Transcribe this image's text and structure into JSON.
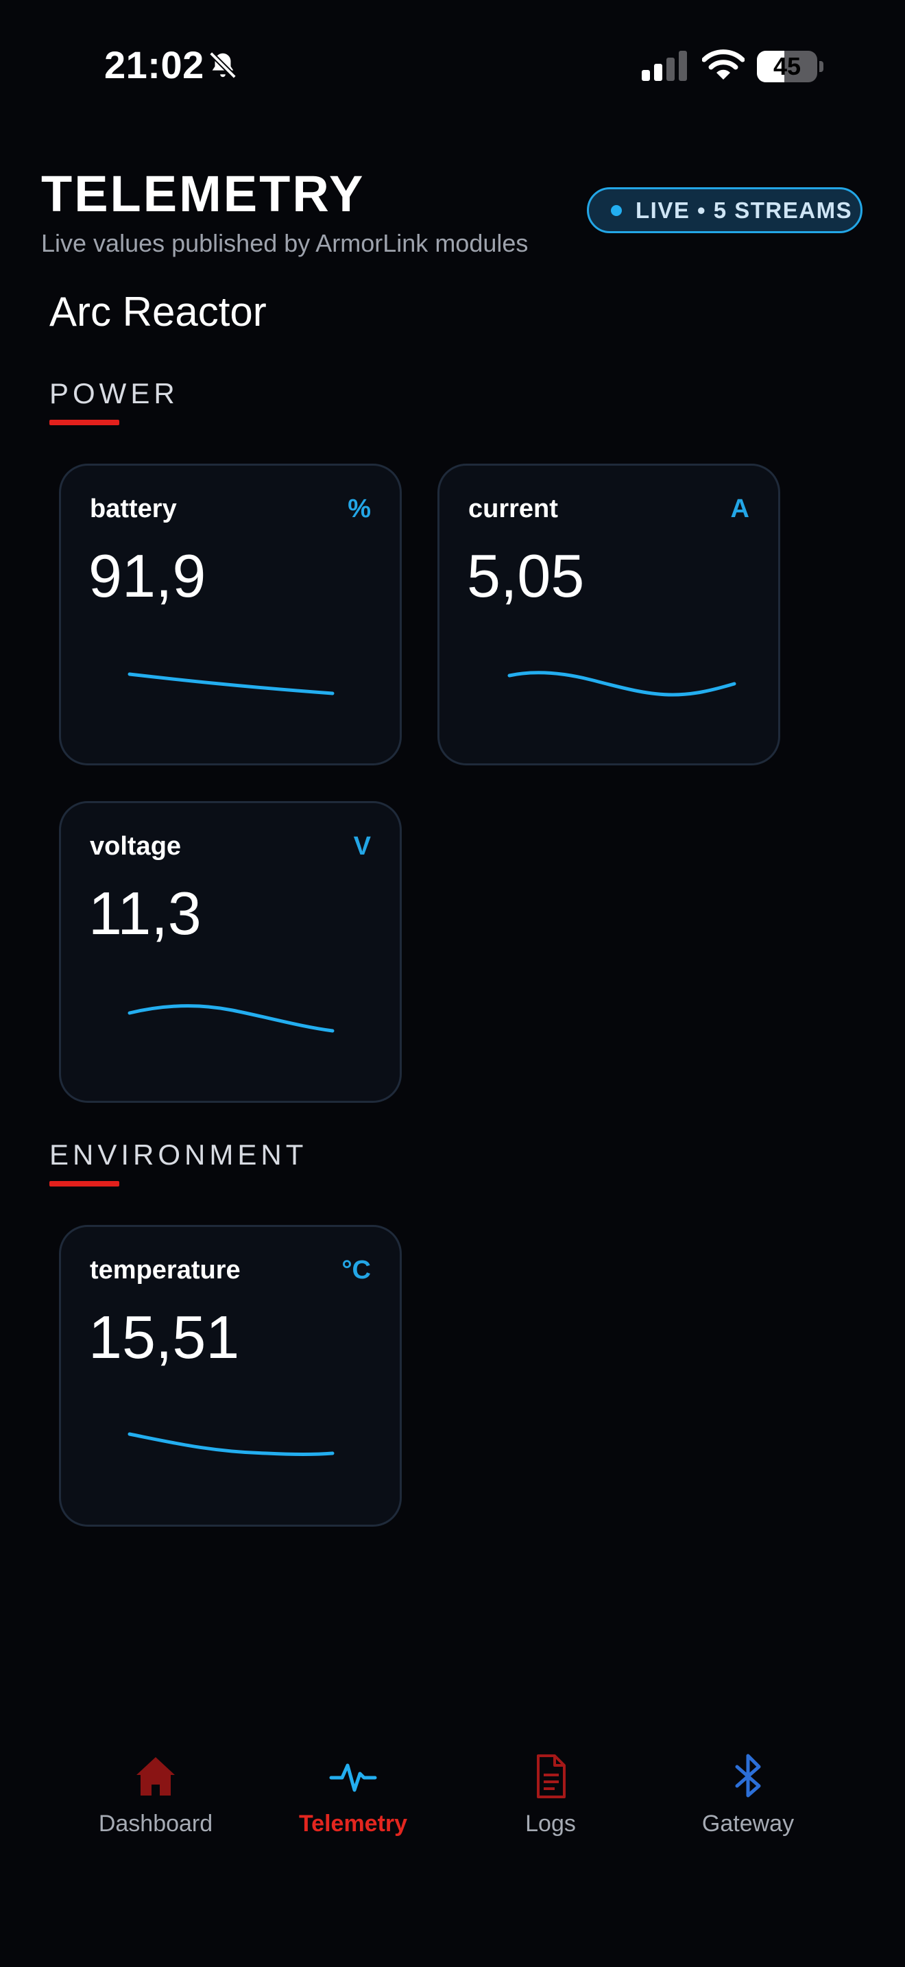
{
  "status_bar": {
    "time": "21:02",
    "silent_icon": "bell-slash-icon",
    "battery_level": "45",
    "battery_fraction": 0.45
  },
  "header": {
    "title": "TELEMETRY",
    "subtitle": "Live values published by ArmorLink modules",
    "live_badge": "LIVE • 5 STREAMS"
  },
  "device": {
    "name": "Arc Reactor"
  },
  "sections": [
    {
      "label": "POWER",
      "metrics": [
        {
          "name": "battery",
          "unit": "%",
          "value": "91,9"
        },
        {
          "name": "current",
          "unit": "A",
          "value": "5,05"
        },
        {
          "name": "voltage",
          "unit": "V",
          "value": "11,3"
        }
      ]
    },
    {
      "label": "ENVIRONMENT",
      "metrics": [
        {
          "name": "temperature",
          "unit": "°C",
          "value": "15,51"
        }
      ]
    }
  ],
  "tabs": [
    {
      "label": "Dashboard",
      "icon": "house-icon",
      "active": false
    },
    {
      "label": "Telemetry",
      "icon": "pulse-icon",
      "active": true
    },
    {
      "label": "Logs",
      "icon": "document-icon",
      "active": false
    },
    {
      "label": "Gateway",
      "icon": "bluetooth-icon",
      "active": false
    }
  ],
  "colors": {
    "background": "#05060a",
    "accent_red": "#e3201c",
    "accent_blue": "#23a6e6",
    "card_background": "#0a0e16",
    "card_border": "#1f2a3a"
  }
}
